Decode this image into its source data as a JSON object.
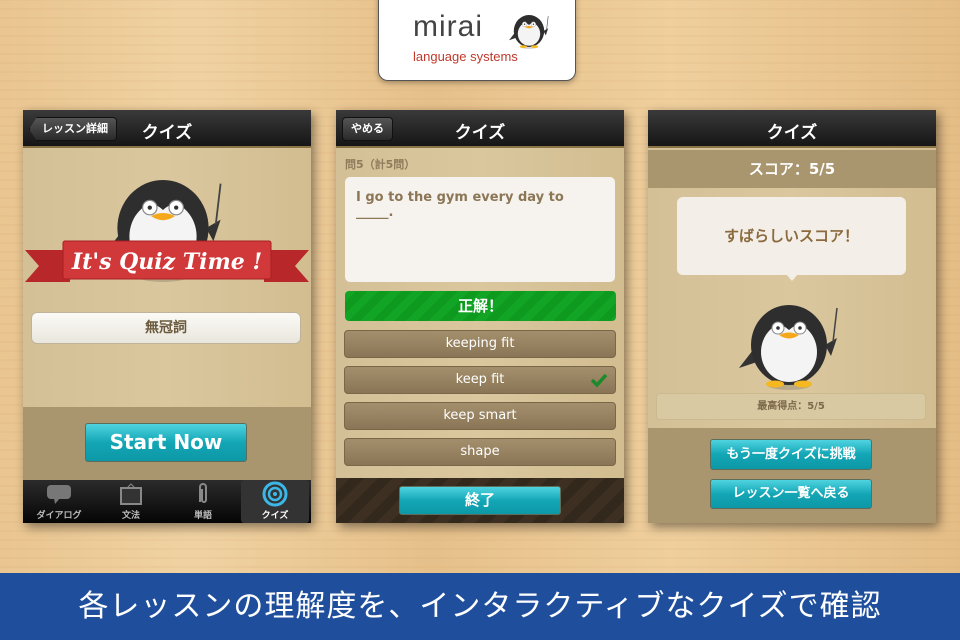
{
  "logo": {
    "name": "mirai",
    "tagline": "language systems"
  },
  "screen1": {
    "title": "クイズ",
    "back_label": "レッスン詳細",
    "ribbon": "It's Quiz Time !",
    "topic": "無冠詞",
    "start_label": "Start Now",
    "tabs": [
      {
        "label": "ダイアログ",
        "icon": "speech-bubble-icon"
      },
      {
        "label": "文法",
        "icon": "blackboard-icon"
      },
      {
        "label": "単語",
        "icon": "paperclip-icon"
      },
      {
        "label": "クイズ",
        "icon": "target-icon",
        "selected": true
      }
    ]
  },
  "screen2": {
    "title": "クイズ",
    "quit_label": "やめる",
    "progress": "問5（計5問）",
    "question": "I go to the gym every day to _____.",
    "result": "正解！",
    "options": [
      {
        "label": "keeping fit"
      },
      {
        "label": "keep fit",
        "correct": true
      },
      {
        "label": "keep smart"
      },
      {
        "label": "shape"
      }
    ],
    "finish_label": "終了"
  },
  "screen3": {
    "title": "クイズ",
    "score": "スコア：5/5",
    "message": "すばらしいスコア！",
    "high_score": "最高得点：5/5",
    "retry_label": "もう一度クイズに挑戦",
    "back_label": "レッスン一覧へ戻る"
  },
  "caption": "各レッスンの理解度を、インタラクティブなクイズで確認",
  "colors": {
    "accent_teal": "#13a6b5",
    "correct_green": "#12a424",
    "banner_blue": "#1f4f9c"
  }
}
